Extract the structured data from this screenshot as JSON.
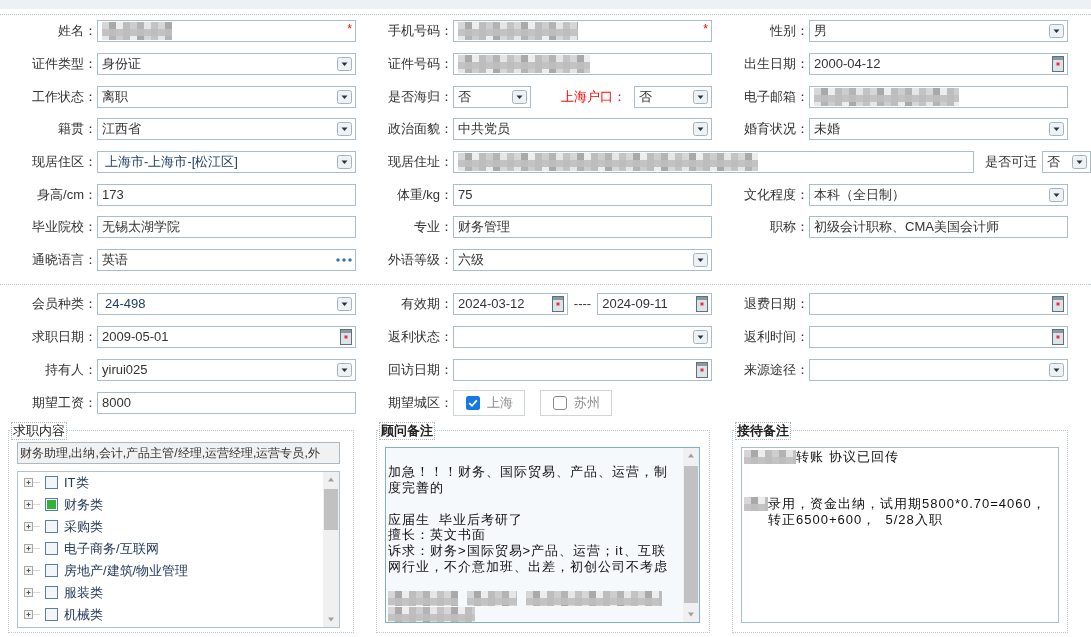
{
  "basic_info": {
    "rows": [
      {
        "cells": [
          {
            "fields": [
              {
                "label": "姓名：",
                "kind": "input",
                "redacted": true,
                "required_mark": "*"
              }
            ]
          },
          {
            "fields": [
              {
                "label": "手机号码：",
                "kind": "input",
                "redacted": true,
                "required_mark": "*"
              }
            ]
          },
          {
            "fields": [
              {
                "label": "性别：",
                "kind": "select",
                "value": "男"
              }
            ]
          }
        ]
      },
      {
        "cells": [
          {
            "fields": [
              {
                "label": "证件类型：",
                "kind": "select",
                "value": "身份证"
              }
            ]
          },
          {
            "fields": [
              {
                "label": "证件号码：",
                "kind": "input",
                "redacted": true
              }
            ]
          },
          {
            "fields": [
              {
                "label": "出生日期：",
                "kind": "date",
                "value": "2000-04-12"
              }
            ]
          }
        ]
      },
      {
        "cells": [
          {
            "fields": [
              {
                "label": "工作状态：",
                "kind": "select",
                "value": "离职"
              }
            ]
          },
          {
            "fields": [
              {
                "label": "是否海归：",
                "kind": "select",
                "value": "否"
              },
              {
                "label": "上海户口：",
                "kind": "select",
                "value": "否",
                "emphasized": true
              }
            ]
          },
          {
            "fields": [
              {
                "label": "电子邮箱：",
                "kind": "input",
                "redacted": true
              }
            ]
          }
        ]
      },
      {
        "cells": [
          {
            "fields": [
              {
                "label": "籍贯：",
                "kind": "select",
                "value": "江西省"
              }
            ]
          },
          {
            "fields": [
              {
                "label": "政治面貌：",
                "kind": "select",
                "value": "中共党员"
              }
            ]
          },
          {
            "fields": [
              {
                "label": "婚育状况：",
                "kind": "select",
                "value": "未婚"
              }
            ]
          }
        ]
      },
      {
        "cells": [
          {
            "fields": [
              {
                "label": "现居住区：",
                "kind": "combo",
                "value": "上海市-上海市-[松江区]"
              }
            ]
          },
          {
            "fields": [
              {
                "label": "现居住址：",
                "kind": "input",
                "redacted": true
              },
              {
                "label": "是否可迁",
                "kind": "select",
                "value": "否"
              }
            ]
          }
        ]
      },
      {
        "cells": [
          {
            "fields": [
              {
                "label": "身高/cm：",
                "kind": "input",
                "value": "173"
              }
            ]
          },
          {
            "fields": [
              {
                "label": "体重/kg：",
                "kind": "input",
                "value": "75"
              }
            ]
          },
          {
            "fields": [
              {
                "label": "文化程度：",
                "kind": "select",
                "value": "本科（全日制）"
              }
            ]
          }
        ]
      },
      {
        "cells": [
          {
            "fields": [
              {
                "label": "毕业院校：",
                "kind": "input",
                "value": "无锡太湖学院"
              }
            ]
          },
          {
            "fields": [
              {
                "label": "专业：",
                "kind": "input",
                "value": "财务管理"
              }
            ]
          },
          {
            "fields": [
              {
                "label": "职称：",
                "kind": "input",
                "value": "初级会计职称、CMA美国会计师"
              }
            ]
          }
        ]
      },
      {
        "cells": [
          {
            "fields": [
              {
                "label": "通晓语言：",
                "kind": "lookup",
                "value": "英语"
              }
            ]
          },
          {
            "fields": [
              {
                "label": "外语等级：",
                "kind": "select",
                "value": "六级"
              }
            ]
          }
        ]
      }
    ]
  },
  "membership": {
    "rows": [
      {
        "cells": [
          {
            "fields": [
              {
                "label": "会员种类：",
                "kind": "combo",
                "value": "24-498"
              }
            ]
          },
          {
            "fields": [
              {
                "label": "有效期：",
                "kind": "date",
                "value": "2024-03-12"
              },
              {
                "kind": "separator",
                "text": "----"
              },
              {
                "kind": "date",
                "value": "2024-09-11"
              }
            ]
          },
          {
            "fields": [
              {
                "label": "退费日期：",
                "kind": "date"
              }
            ]
          }
        ]
      },
      {
        "cells": [
          {
            "fields": [
              {
                "label": "求职日期：",
                "kind": "date",
                "value": "2009-05-01"
              }
            ]
          },
          {
            "fields": [
              {
                "label": "返利状态：",
                "kind": "select"
              }
            ]
          },
          {
            "fields": [
              {
                "label": "返利时间：",
                "kind": "date"
              }
            ]
          }
        ]
      },
      {
        "cells": [
          {
            "fields": [
              {
                "label": "持有人：",
                "kind": "select",
                "value": "yirui025"
              }
            ]
          },
          {
            "fields": [
              {
                "label": "回访日期：",
                "kind": "date"
              }
            ]
          },
          {
            "fields": [
              {
                "label": "来源途径：",
                "kind": "select"
              }
            ]
          }
        ]
      },
      {
        "cells": [
          {
            "fields": [
              {
                "label": "期望工资：",
                "kind": "input",
                "value": "8000"
              }
            ]
          },
          {
            "fields": [
              {
                "label": "期望城区：",
                "kind": "checkbox_group",
                "options": [
                  {
                    "label": "上海",
                    "checked": true
                  },
                  {
                    "label": "苏州",
                    "checked": false
                  }
                ]
              }
            ]
          }
        ]
      }
    ]
  },
  "panels": [
    {
      "kind": "tree",
      "title": "求职内容",
      "scrollable": true,
      "summary": "财务助理,出纳,会计,产品主管/经理,运营经理,运营专员,外",
      "items": [
        {
          "label": "IT类",
          "checked": false,
          "expanded": false
        },
        {
          "label": "财务类",
          "checked": true,
          "expanded": false
        },
        {
          "label": "采购类",
          "checked": false,
          "expanded": false
        },
        {
          "label": "电子商务/互联网",
          "checked": false,
          "expanded": false
        },
        {
          "label": "房地产/建筑/物业管理",
          "checked": false,
          "expanded": false
        },
        {
          "label": "服装类",
          "checked": false,
          "expanded": false
        },
        {
          "label": "机械类",
          "checked": false,
          "expanded": false
        }
      ]
    },
    {
      "kind": "notes",
      "title": "顾问备注",
      "focused": true,
      "scrollable": true,
      "lines": [
        {
          "kind": "blank"
        },
        {
          "kind": "text",
          "text": "加急！！！财务、国际贸易、产品、运营，制度完善的"
        },
        {
          "kind": "blank"
        },
        {
          "kind": "text",
          "text": "应届生  毕业后考研了"
        },
        {
          "kind": "text",
          "text": "擅长：英文书面"
        },
        {
          "kind": "text",
          "text": "诉求：财务>国际贸易>产品、运营；it、互联网行业，不介意加班、出差，初创公司不考虑"
        },
        {
          "kind": "blank"
        },
        {
          "kind": "redacted"
        },
        {
          "kind": "redacted"
        }
      ]
    },
    {
      "kind": "notes",
      "title": "接待备注",
      "focused": false,
      "scrollable": false,
      "lines": [
        {
          "kind": "text",
          "text": "转账 协议已回传",
          "redacted_prefix": true
        },
        {
          "kind": "blank"
        },
        {
          "kind": "blank"
        },
        {
          "kind": "text",
          "text": "录用，资金出纳，试用期5800*0.70=4060，转正6500+600，  5/28入职",
          "redacted_prefix": true
        }
      ]
    }
  ]
}
